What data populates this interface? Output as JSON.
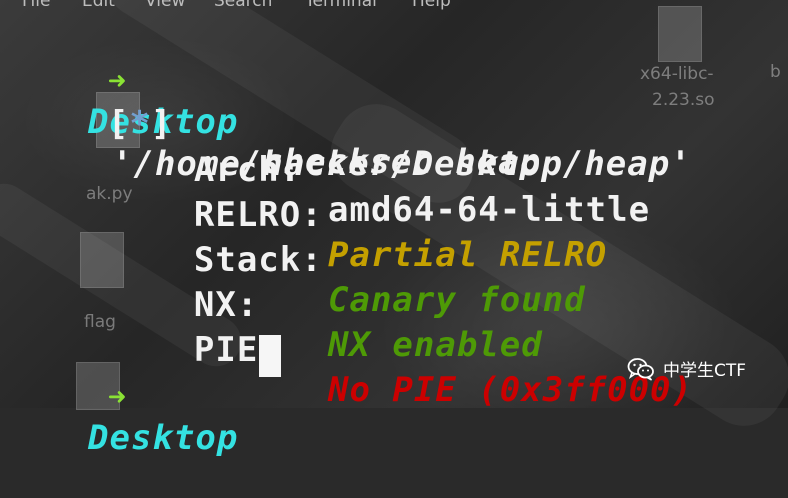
{
  "menu": [
    "File",
    "Edit",
    "View",
    "Search",
    "Terminal",
    "Help"
  ],
  "desktop_icons": {
    "libc_label_1": "x64-libc-",
    "libc_label_2": "2.23.so",
    "extra_label": "b",
    "py_label": "ak.py",
    "flag_label": "flag"
  },
  "terminal": {
    "prompt_arrow": "➜",
    "prompt_dir": "Desktop",
    "command": "checksec heap",
    "result_prefix": "[*]",
    "result_path": "'/home/hacker/Desktop/heap'",
    "rows": [
      {
        "label": "Arch:",
        "value": "amd64-64-little",
        "color": "#f2f2f2"
      },
      {
        "label": "RELRO:",
        "value": "Partial RELRO",
        "color": "#c4a000"
      },
      {
        "label": "Stack:",
        "value": "Canary found",
        "color": "#4e9a06"
      },
      {
        "label": "NX:",
        "value": "NX enabled",
        "color": "#4e9a06"
      },
      {
        "label": "PIE:",
        "value": "No PIE (0x3ff000)",
        "color": "#cc0000"
      }
    ],
    "prompt2_dir": "Desktop"
  },
  "watermark": {
    "text": "中学生CTF",
    "icon": "wechat-icon"
  },
  "colors": {
    "prompt_arrow": "#8ae234",
    "prompt_dir": "#34e2e2",
    "bracket_star": "#729fcf"
  }
}
